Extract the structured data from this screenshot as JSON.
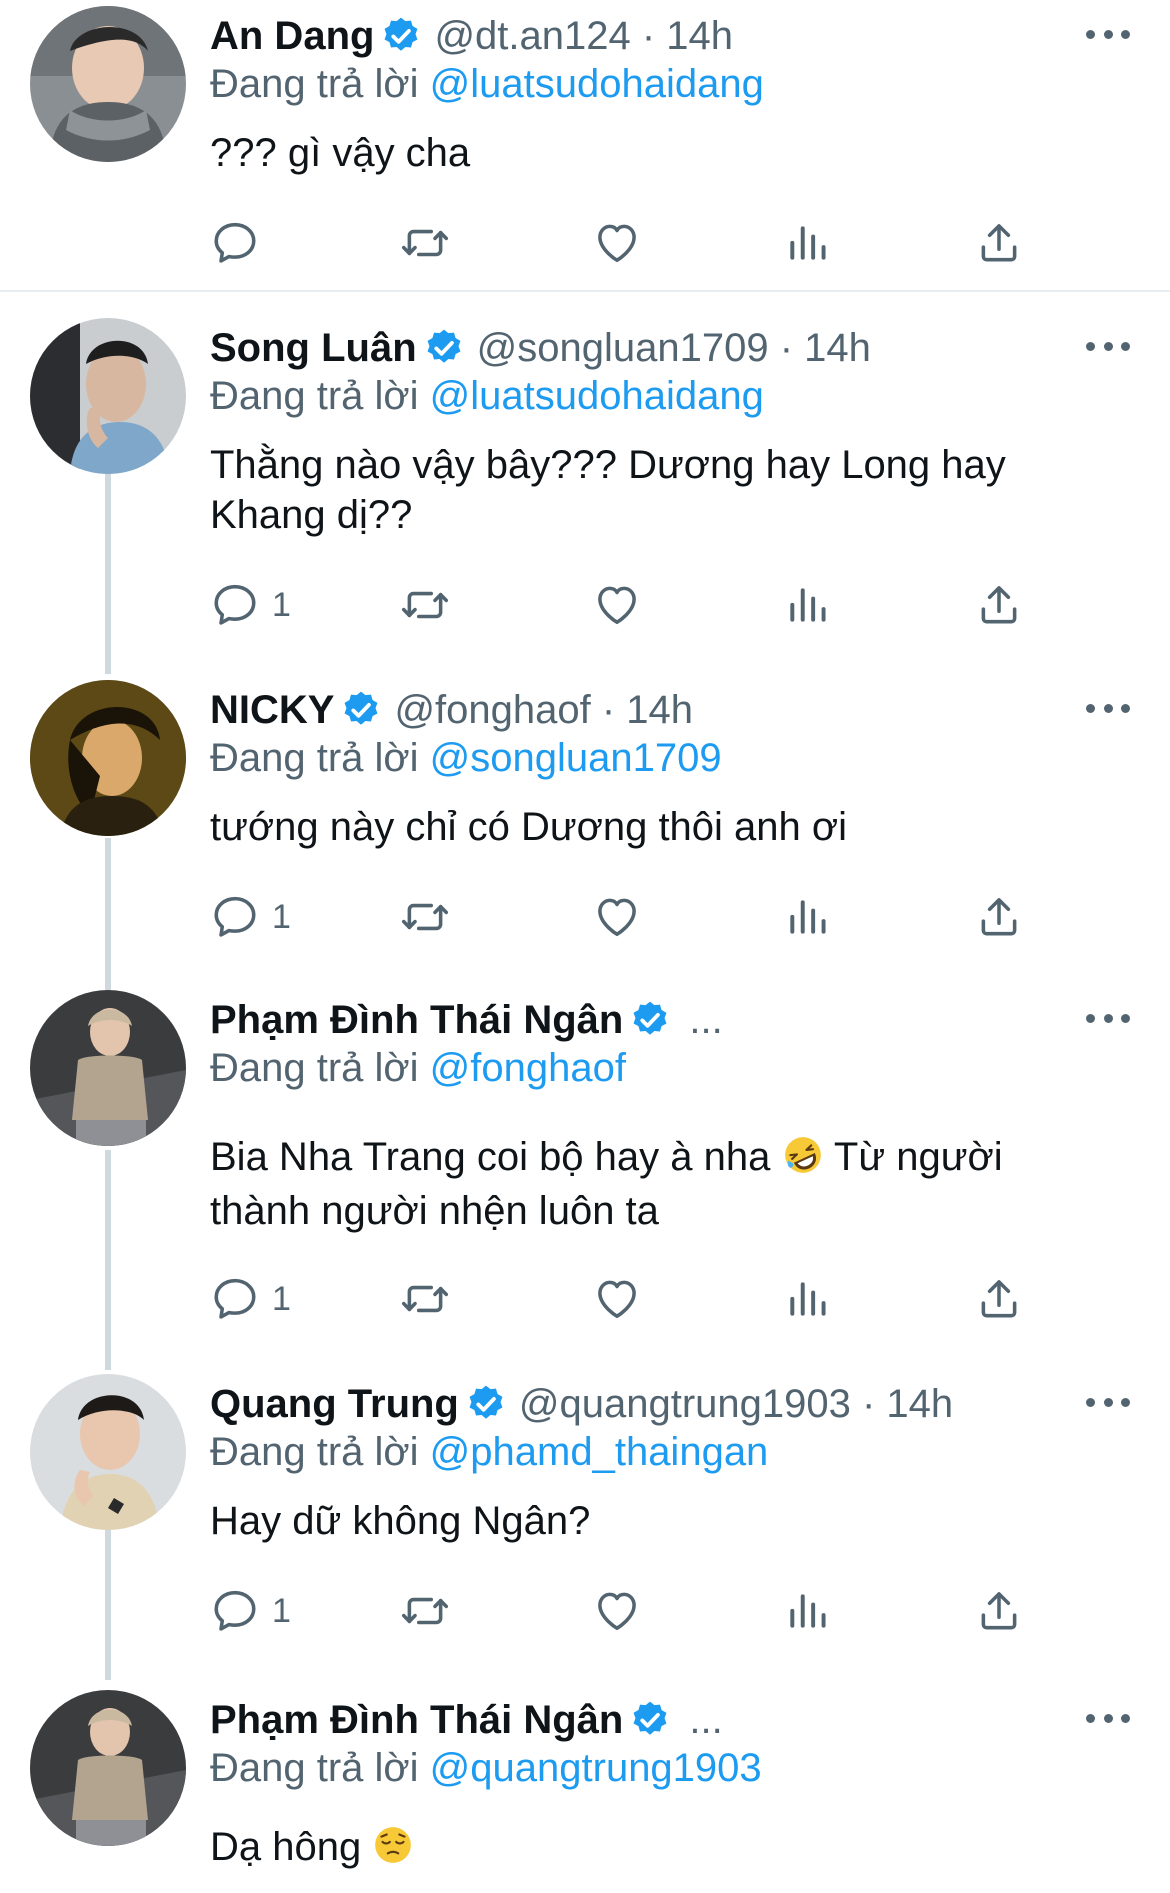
{
  "colors": {
    "link": "#1d9bf0",
    "secondary": "#536471",
    "text": "#0f1419",
    "verified": "#1d9bf0"
  },
  "tweets": [
    {
      "name": "An Dang",
      "handle_time": "@dt.an124 · 14h",
      "truncated_marker": "",
      "reply_prefix": "Đang trả lời",
      "reply_to": "@luatsudohaidang",
      "text": [
        "??? gì vậy cha"
      ],
      "reply_count": "",
      "verified": true
    },
    {
      "name": "Song Luân",
      "handle_time": "@songluan1709 · 14h",
      "truncated_marker": "",
      "reply_prefix": "Đang trả lời",
      "reply_to": "@luatsudohaidang",
      "text": [
        "Thằng nào vậy bây??? Dương hay Long hay",
        "Khang dị??"
      ],
      "reply_count": "1",
      "verified": true
    },
    {
      "name": "NICKY",
      "handle_time": "@fonghaof · 14h",
      "truncated_marker": "",
      "reply_prefix": "Đang trả lời",
      "reply_to": "@songluan1709",
      "text": [
        "tướng này chỉ có Dương thôi anh ơi"
      ],
      "reply_count": "1",
      "verified": true
    },
    {
      "name": "Phạm Đình Thái Ngân",
      "handle_time": "",
      "truncated_marker": "...",
      "reply_prefix": "Đang trả lời",
      "reply_to": "@fonghaof",
      "text_line1_before": "Bia Nha Trang coi bộ hay à nha",
      "text_line1_after": "Từ người",
      "text_line2": "thành người nhện luôn ta",
      "emoji": "rolling-on-floor-laughing-emoji",
      "reply_count": "1",
      "verified": true
    },
    {
      "name": "Quang Trung",
      "handle_time": "@quangtrung1903 · 14h",
      "truncated_marker": "",
      "reply_prefix": "Đang trả lời",
      "reply_to": "@phamd_thaingan",
      "text": [
        "Hay dữ không Ngân?"
      ],
      "reply_count": "1",
      "verified": true
    },
    {
      "name": "Phạm Đình Thái Ngân",
      "handle_time": "",
      "truncated_marker": "...",
      "reply_prefix": "Đang trả lời",
      "reply_to": "@quangtrung1903",
      "text_before_emoji": "Dạ hông",
      "emoji": "pensive-face-emoji",
      "reply_count": "",
      "verified": true
    }
  ],
  "icons": {
    "reply": "reply-icon",
    "retweet": "retweet-icon",
    "like": "heart-icon",
    "views": "views-icon",
    "share": "share-icon",
    "more": "more-dots-icon",
    "verified": "verified-badge-icon"
  }
}
